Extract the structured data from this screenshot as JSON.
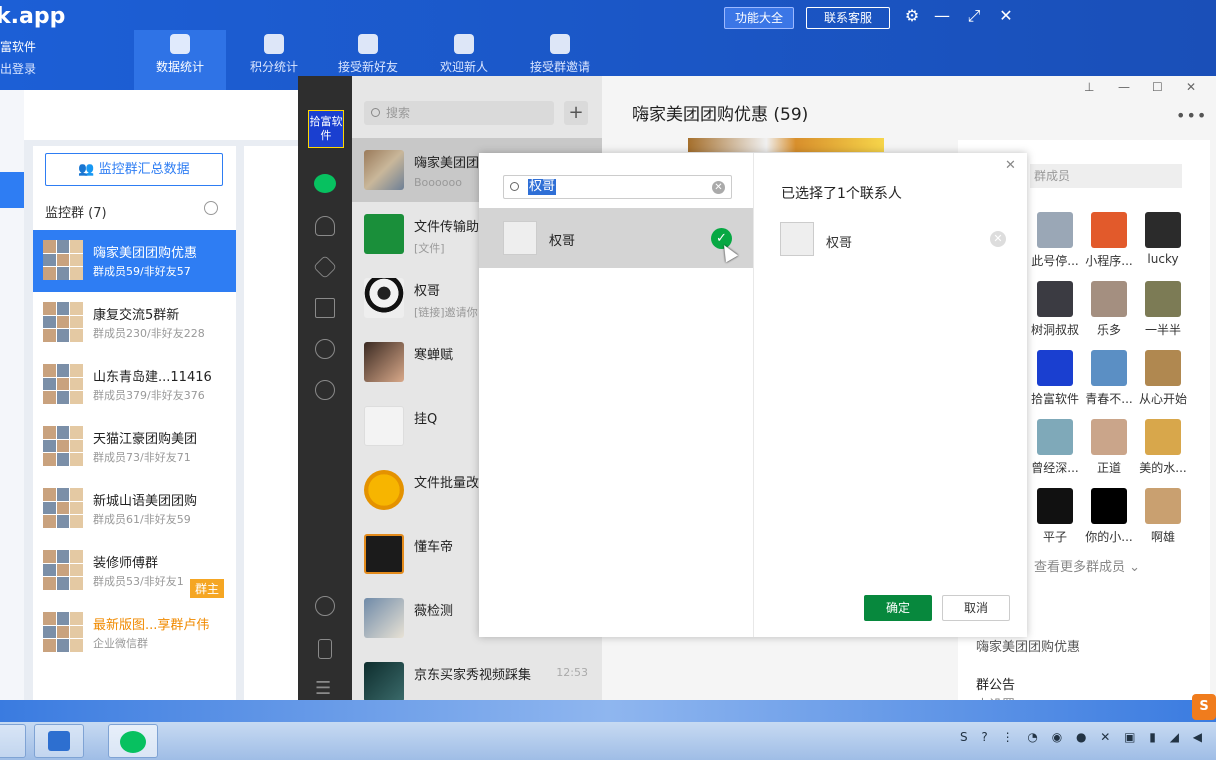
{
  "bg_app": {
    "logo_text": "k.app",
    "app_name": "富软件",
    "logout": "出登录",
    "nav": [
      {
        "label": "数据统计",
        "selected": true
      },
      {
        "label": "积分统计"
      },
      {
        "label": "接受新好友"
      },
      {
        "label": "欢迎新人"
      },
      {
        "label": "接受群邀请"
      }
    ],
    "functions_btn": "功能大全",
    "service_btn": "联系客服",
    "summary_btn": "监控群汇总数据",
    "monitor_title": "监控群 (7)",
    "groups": [
      {
        "name": "嗨家美团团购优惠",
        "sub": "群成员59/非好友57",
        "selected": true
      },
      {
        "name": "康复交流5群新",
        "sub": "群成员230/非好友228"
      },
      {
        "name": "山东青岛建...11416",
        "sub": "群成员379/非好友376"
      },
      {
        "name": "天猫江豪团购美团",
        "sub": "群成员73/非好友71"
      },
      {
        "name": "新城山语美团团购",
        "sub": "群成员61/非好友59"
      },
      {
        "name": "装修师傅群",
        "sub": "群成员53/非好友1"
      },
      {
        "name": "最新版图...享群卢伟",
        "sub": "企业微信群",
        "highlight": true
      }
    ],
    "owner_tag": "群主"
  },
  "wechat": {
    "logo": "拾富软件",
    "search_placeholder": "搜索",
    "chats": [
      {
        "name": "嗨家美团团购",
        "msg": "Boooooo"
      },
      {
        "name": "文件传输助",
        "msg": "[文件]"
      },
      {
        "name": "权哥",
        "msg": "[链接]邀请你"
      },
      {
        "name": "寒蝉赋",
        "msg": ""
      },
      {
        "name": "挂Q",
        "msg": ""
      },
      {
        "name": "文件批量改",
        "msg": ""
      },
      {
        "name": "懂车帝",
        "msg": ""
      },
      {
        "name": "薇检测",
        "msg": ""
      },
      {
        "name": "京东买家秀视频踩集",
        "msg": "",
        "time": "12:53"
      }
    ],
    "chat_title": "嗨家美团团购优惠 (59)",
    "member_search": "群成员",
    "members": [
      "此号停...",
      "小程序...",
      "lucky",
      "树洞叔叔",
      "乐多",
      "一半半",
      "拾富软件",
      "青春不...",
      "从心开始",
      "曾经深...",
      "正道",
      "美的水...",
      "平子",
      "你的小...",
      "啊雄"
    ],
    "more_members": "查看更多群成员",
    "group_name": "嗨家美团团购优惠",
    "notice_title": "群公告",
    "notice_value": "未设置"
  },
  "dialog": {
    "search_value": "权哥",
    "result_name": "权哥",
    "selected_count": "已选择了1个联系人",
    "selected_name": "权哥",
    "ok": "确定",
    "cancel": "取消"
  },
  "colors": {
    "accent_blue": "#2e7df3",
    "wechat_green": "#07c160",
    "ok_green": "#07883d"
  }
}
